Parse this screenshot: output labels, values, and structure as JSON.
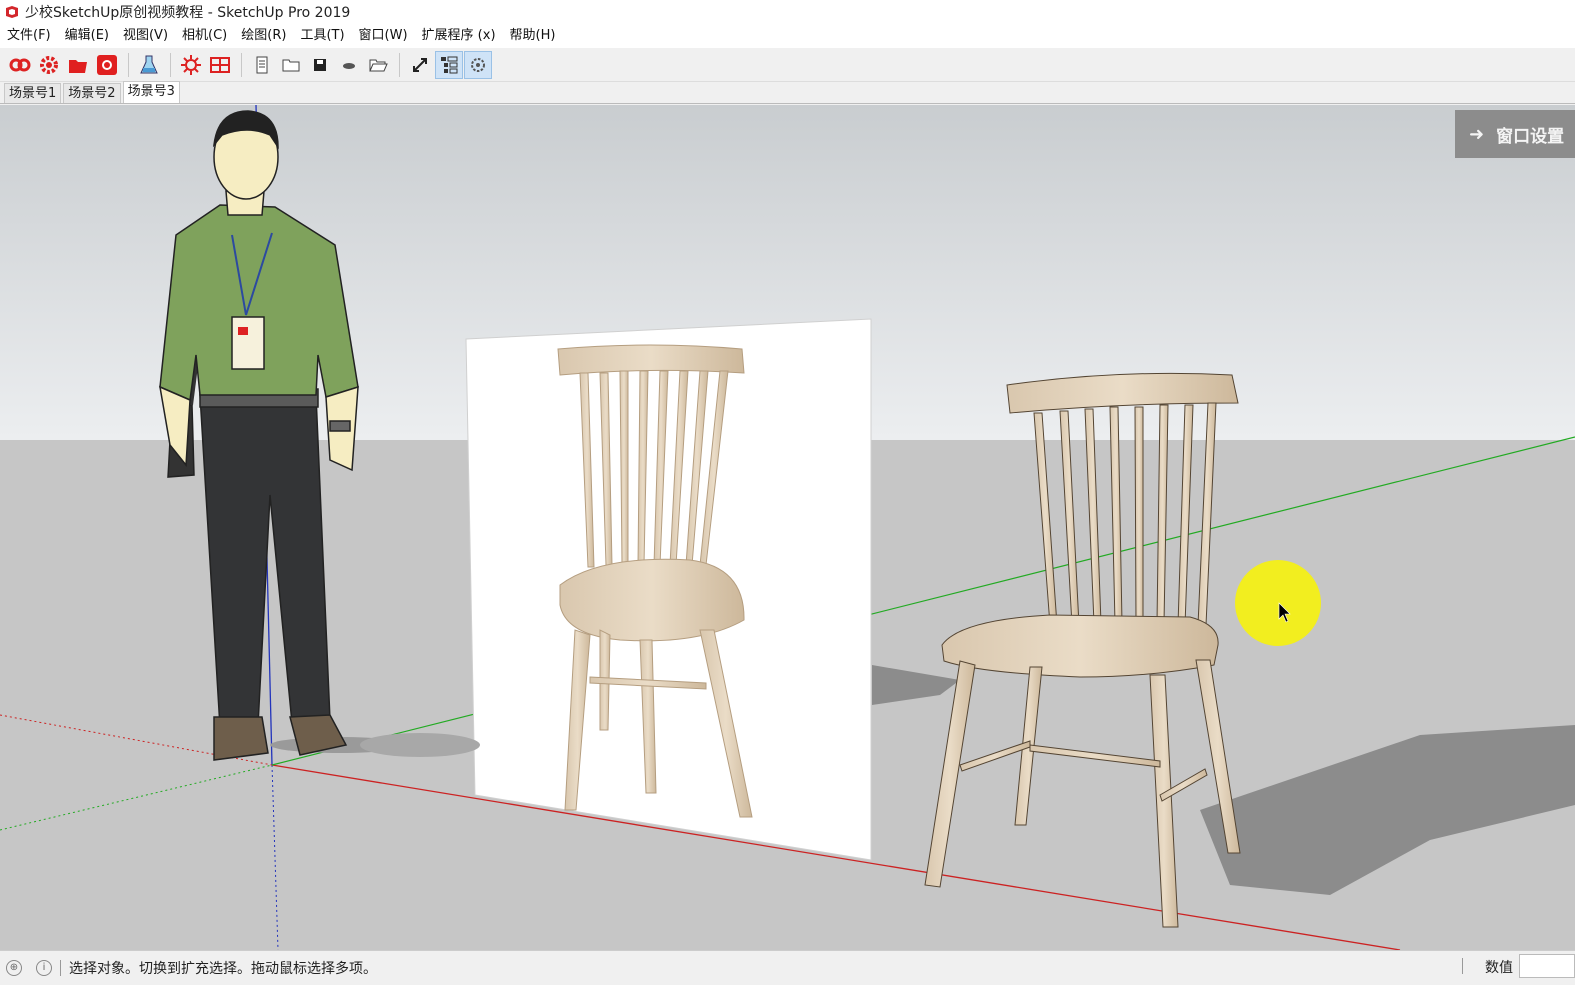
{
  "window": {
    "title": "少校SketchUp原创视频教程 - SketchUp Pro 2019"
  },
  "menu": [
    "文件(F)",
    "编辑(E)",
    "视图(V)",
    "相机(C)",
    "绘图(R)",
    "工具(T)",
    "窗口(W)",
    "扩展程序 (x)",
    "帮助(H)"
  ],
  "toolbar": {
    "icons": [
      "infinity-icon",
      "gear-red-icon",
      "folder-red-icon",
      "camera-red-icon",
      "flask-icon",
      "sun-gear-icon",
      "grid-red-icon",
      "page-icon",
      "folder-icon",
      "save-icon",
      "cloud-icon",
      "open-folder-icon",
      "expand-icon",
      "outliner-icon",
      "settings-icon"
    ]
  },
  "scenes": {
    "tabs": [
      "场景号1",
      "场景号2",
      "场景号3"
    ],
    "active_index": 2
  },
  "tray": {
    "window_settings_label": "窗口设置"
  },
  "status": {
    "message": "选择对象。切换到扩充选择。拖动鼠标选择多项。",
    "measurements_label": "数值",
    "measurements_value": ""
  },
  "colors": {
    "sky": "#d9dde0",
    "ground": "#c4c4c4",
    "x_axis": "#cc2222",
    "y_axis": "#22aa22",
    "z_axis": "#2233bb",
    "cursor_highlight": "#f2ee1f"
  }
}
